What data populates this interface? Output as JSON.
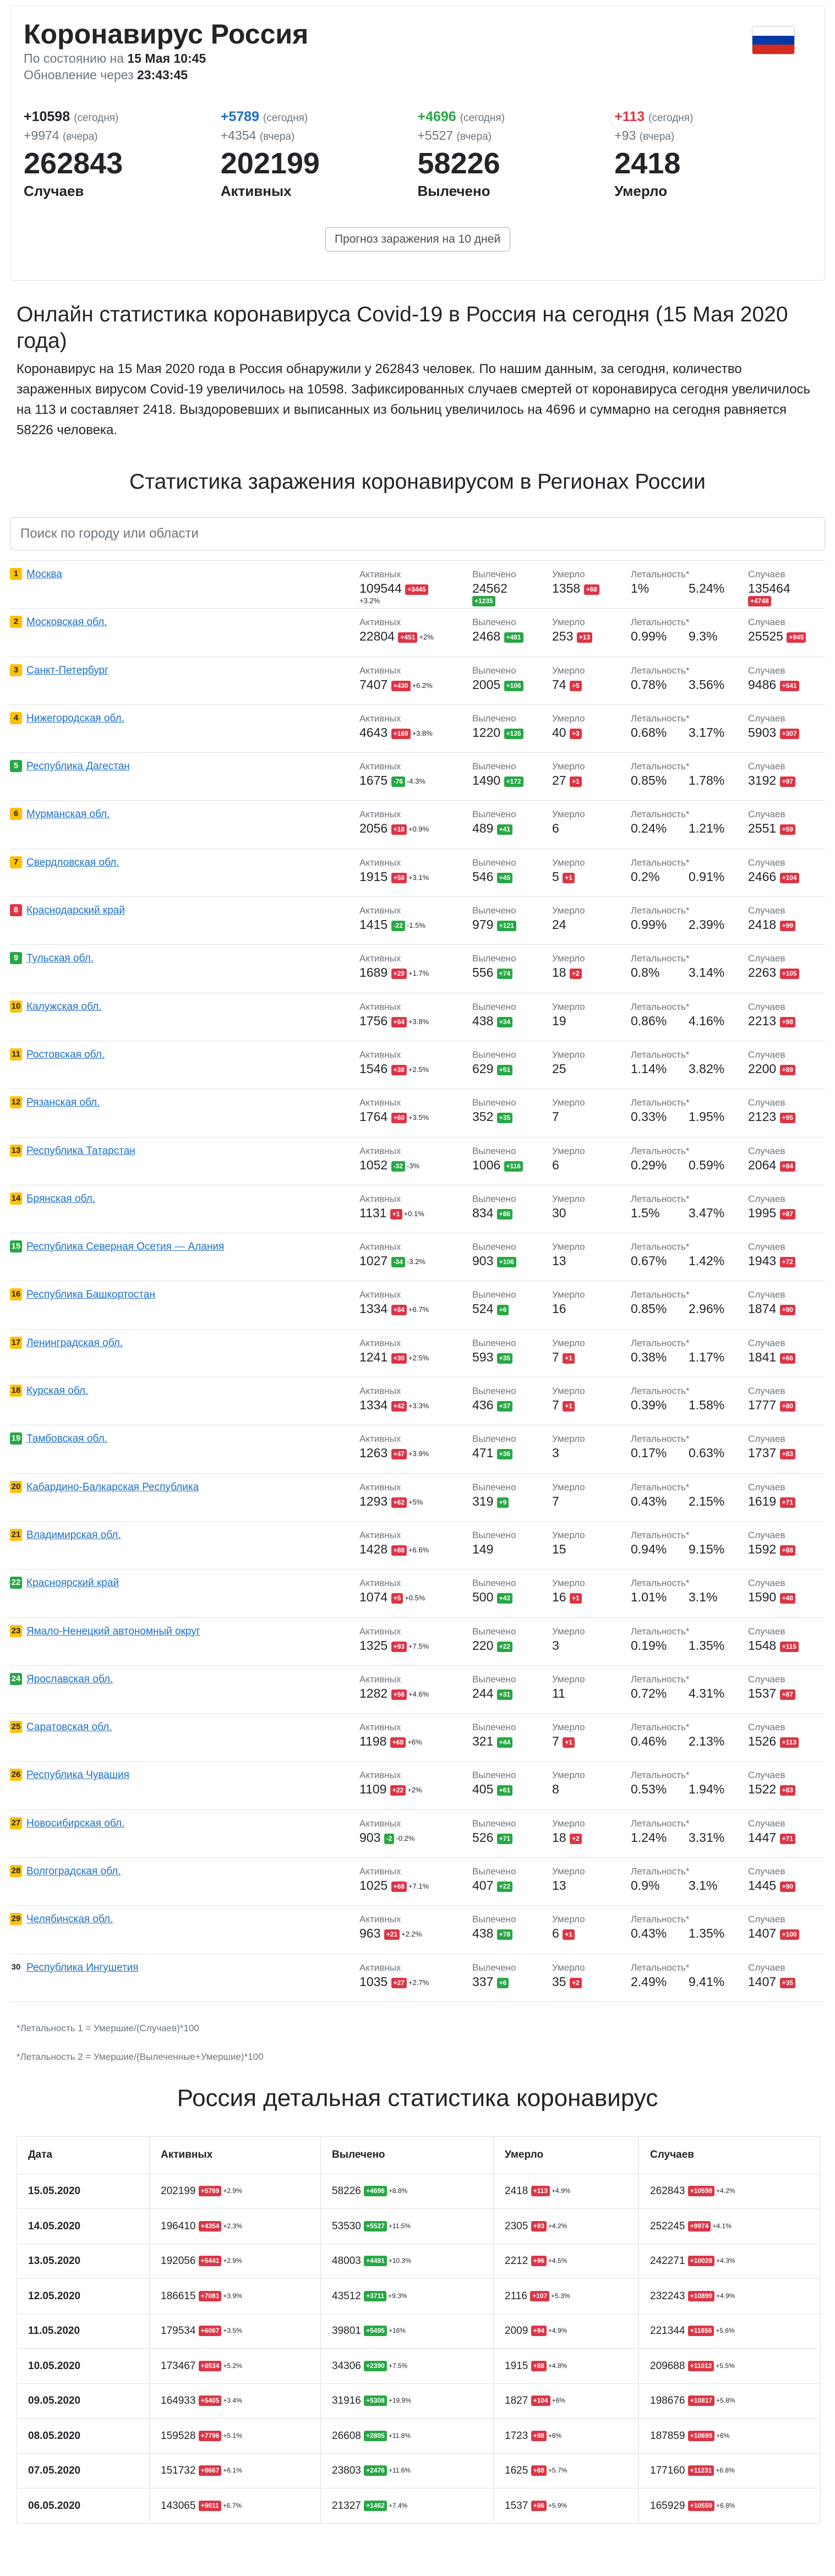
{
  "header": {
    "title": "Коронавирус Россия",
    "asof_label": "По состоянию на",
    "asof": "15 Мая 10:45",
    "update_label": "Обновление через",
    "update": "23:43:45"
  },
  "colors": {
    "blue": "#1f6fc7",
    "green": "#28a745",
    "red": "#dc3545",
    "yellow": "#ffc107"
  },
  "stats": [
    {
      "today": "+10598",
      "today_label": "(сегодня)",
      "yest": "+9974",
      "yest_label": "(вчера)",
      "total": "262843",
      "caption": "Случаев",
      "color": "dark"
    },
    {
      "today": "+5789",
      "today_label": "(сегодня)",
      "yest": "+4354",
      "yest_label": "(вчера)",
      "total": "202199",
      "caption": "Активных",
      "color": "blue"
    },
    {
      "today": "+4696",
      "today_label": "(сегодня)",
      "yest": "+5527",
      "yest_label": "(вчера)",
      "total": "58226",
      "caption": "Вылечено",
      "color": "green"
    },
    {
      "today": "+113",
      "today_label": "(сегодня)",
      "yest": "+93",
      "yest_label": "(вчера)",
      "total": "2418",
      "caption": "Умерло",
      "color": "red"
    }
  ],
  "forecast_button": "Прогноз заражения на 10 дней",
  "online_title": "Онлайн статистика коронавируса Covid-19 в Россия на сегодня (15 Мая 2020 года)",
  "intro": "Коронавирус на 15 Мая 2020 года в Россия обнаружили у 262843 человек. По нашим данным, за сегодня, количество зараженных вирусом Covid-19 увеличилось на 10598. Зафиксированных случаев смертей от коронавируса сегодня увеличилось на 113 и составляет 2418. Выздоровевших и выписанных из больниц увеличилось на 4696 и суммарно на сегодня равняется 58226 человека.",
  "regions_title": "Статистика заражения коронавирусом в Регионах России",
  "search_placeholder": "Поиск по городу или области",
  "labels": {
    "active": "Активных",
    "recovered": "Вылечено",
    "died": "Умерло",
    "lethality": "Летальность*",
    "cases": "Случаев"
  },
  "regions": [
    {
      "rank": "1",
      "badge": "y",
      "name": "Москва",
      "active": "109544",
      "ad": "+3445",
      "ap": "+3.2%",
      "rec": "24562",
      "rd": "+1235",
      "died": "1358",
      "dd": "+68",
      "l1": "1%",
      "l2": "5.24%",
      "cases": "135464",
      "cd": "+4748"
    },
    {
      "rank": "2",
      "badge": "y",
      "name": "Московская обл.",
      "active": "22804",
      "ad": "+451",
      "ap": "+2%",
      "rec": "2468",
      "rd": "+481",
      "died": "253",
      "dd": "+13",
      "l1": "0.99%",
      "l2": "9.3%",
      "cases": "25525",
      "cd": "+945"
    },
    {
      "rank": "3",
      "badge": "y",
      "name": "Санкт-Петербург",
      "active": "7407",
      "ad": "+430",
      "ap": "+6.2%",
      "rec": "2005",
      "rd": "+106",
      "died": "74",
      "dd": "+5",
      "l1": "0.78%",
      "l2": "3.56%",
      "cases": "9486",
      "cd": "+541"
    },
    {
      "rank": "4",
      "badge": "y",
      "name": "Нижегородская обл.",
      "active": "4643",
      "ad": "+169",
      "ap": "+3.8%",
      "rec": "1220",
      "rd": "+135",
      "died": "40",
      "dd": "+3",
      "l1": "0.68%",
      "l2": "3.17%",
      "cases": "5903",
      "cd": "+307"
    },
    {
      "rank": "5",
      "badge": "g",
      "name": "Республика Дагестан",
      "active": "1675",
      "ad": "-76",
      "ap": "-4.3%",
      "rec": "1490",
      "rd": "+172",
      "died": "27",
      "dd": "+1",
      "l1": "0.85%",
      "l2": "1.78%",
      "cases": "3192",
      "cd": "+97"
    },
    {
      "rank": "6",
      "badge": "y",
      "name": "Мурманская обл.",
      "active": "2056",
      "ad": "+18",
      "ap": "+0.9%",
      "rec": "489",
      "rd": "+41",
      "died": "6",
      "dd": "",
      "l1": "0.24%",
      "l2": "1.21%",
      "cases": "2551",
      "cd": "+59"
    },
    {
      "rank": "7",
      "badge": "y",
      "name": "Свердловская обл.",
      "active": "1915",
      "ad": "+58",
      "ap": "+3.1%",
      "rec": "546",
      "rd": "+45",
      "died": "5",
      "dd": "+1",
      "l1": "0.2%",
      "l2": "0.91%",
      "cases": "2466",
      "cd": "+104"
    },
    {
      "rank": "8",
      "badge": "r",
      "name": "Краснодарский край",
      "active": "1415",
      "ad": "-22",
      "ap": "-1.5%",
      "rec": "979",
      "rd": "+121",
      "died": "24",
      "dd": "",
      "l1": "0.99%",
      "l2": "2.39%",
      "cases": "2418",
      "cd": "+99"
    },
    {
      "rank": "9",
      "badge": "g",
      "name": "Тульская обл.",
      "active": "1689",
      "ad": "+29",
      "ap": "+1.7%",
      "rec": "556",
      "rd": "+74",
      "died": "18",
      "dd": "+2",
      "l1": "0.8%",
      "l2": "3.14%",
      "cases": "2263",
      "cd": "+105"
    },
    {
      "rank": "10",
      "badge": "y",
      "name": "Калужская обл.",
      "active": "1756",
      "ad": "+64",
      "ap": "+3.8%",
      "rec": "438",
      "rd": "+34",
      "died": "19",
      "dd": "",
      "l1": "0.86%",
      "l2": "4.16%",
      "cases": "2213",
      "cd": "+98"
    },
    {
      "rank": "11",
      "badge": "y",
      "name": "Ростовская обл.",
      "active": "1546",
      "ad": "+38",
      "ap": "+2.5%",
      "rec": "629",
      "rd": "+51",
      "died": "25",
      "dd": "",
      "l1": "1.14%",
      "l2": "3.82%",
      "cases": "2200",
      "cd": "+89"
    },
    {
      "rank": "12",
      "badge": "y",
      "name": "Рязанская обл.",
      "active": "1764",
      "ad": "+60",
      "ap": "+3.5%",
      "rec": "352",
      "rd": "+35",
      "died": "7",
      "dd": "",
      "l1": "0.33%",
      "l2": "1.95%",
      "cases": "2123",
      "cd": "+95"
    },
    {
      "rank": "13",
      "badge": "y",
      "name": "Республика Татарстан",
      "active": "1052",
      "ad": "-32",
      "ap": "-3%",
      "rec": "1006",
      "rd": "+116",
      "died": "6",
      "dd": "",
      "l1": "0.29%",
      "l2": "0.59%",
      "cases": "2064",
      "cd": "+84"
    },
    {
      "rank": "14",
      "badge": "y",
      "name": "Брянская обл.",
      "active": "1131",
      "ad": "+1",
      "ap": "+0.1%",
      "rec": "834",
      "rd": "+86",
      "died": "30",
      "dd": "",
      "l1": "1.5%",
      "l2": "3.47%",
      "cases": "1995",
      "cd": "+87"
    },
    {
      "rank": "15",
      "badge": "g",
      "name": "Республика Северная Осетия — Алания",
      "active": "1027",
      "ad": "-34",
      "ap": "-3.2%",
      "rec": "903",
      "rd": "+106",
      "died": "13",
      "dd": "",
      "l1": "0.67%",
      "l2": "1.42%",
      "cases": "1943",
      "cd": "+72"
    },
    {
      "rank": "16",
      "badge": "y",
      "name": "Республика Башкортостан",
      "active": "1334",
      "ad": "+84",
      "ap": "+6.7%",
      "rec": "524",
      "rd": "+6",
      "died": "16",
      "dd": "",
      "l1": "0.85%",
      "l2": "2.96%",
      "cases": "1874",
      "cd": "+90"
    },
    {
      "rank": "17",
      "badge": "y",
      "name": "Ленинградская обл.",
      "active": "1241",
      "ad": "+30",
      "ap": "+2.5%",
      "rec": "593",
      "rd": "+35",
      "died": "7",
      "dd": "+1",
      "l1": "0.38%",
      "l2": "1.17%",
      "cases": "1841",
      "cd": "+66"
    },
    {
      "rank": "18",
      "badge": "y",
      "name": "Курская обл.",
      "active": "1334",
      "ad": "+42",
      "ap": "+3.3%",
      "rec": "436",
      "rd": "+37",
      "died": "7",
      "dd": "+1",
      "l1": "0.39%",
      "l2": "1.58%",
      "cases": "1777",
      "cd": "+80"
    },
    {
      "rank": "19",
      "badge": "g",
      "name": "Тамбовская обл.",
      "active": "1263",
      "ad": "+47",
      "ap": "+3.9%",
      "rec": "471",
      "rd": "+36",
      "died": "3",
      "dd": "",
      "l1": "0.17%",
      "l2": "0.63%",
      "cases": "1737",
      "cd": "+83"
    },
    {
      "rank": "20",
      "badge": "y",
      "name": "Кабардино-Балкарская Республика",
      "active": "1293",
      "ad": "+62",
      "ap": "+5%",
      "rec": "319",
      "rd": "+9",
      "died": "7",
      "dd": "",
      "l1": "0.43%",
      "l2": "2.15%",
      "cases": "1619",
      "cd": "+71"
    },
    {
      "rank": "21",
      "badge": "y",
      "name": "Владимирская обл.",
      "active": "1428",
      "ad": "+88",
      "ap": "+6.6%",
      "rec": "149",
      "rd": "",
      "died": "15",
      "dd": "",
      "l1": "0.94%",
      "l2": "9.15%",
      "cases": "1592",
      "cd": "+88"
    },
    {
      "rank": "22",
      "badge": "g",
      "name": "Красноярский край",
      "active": "1074",
      "ad": "+5",
      "ap": "+0.5%",
      "rec": "500",
      "rd": "+42",
      "died": "16",
      "dd": "+1",
      "l1": "1.01%",
      "l2": "3.1%",
      "cases": "1590",
      "cd": "+48"
    },
    {
      "rank": "23",
      "badge": "y",
      "name": "Ямало-Ненецкий автономный округ",
      "active": "1325",
      "ad": "+93",
      "ap": "+7.5%",
      "rec": "220",
      "rd": "+22",
      "died": "3",
      "dd": "",
      "l1": "0.19%",
      "l2": "1.35%",
      "cases": "1548",
      "cd": "+115"
    },
    {
      "rank": "24",
      "badge": "g",
      "name": "Ярославская обл.",
      "active": "1282",
      "ad": "+56",
      "ap": "+4.6%",
      "rec": "244",
      "rd": "+31",
      "died": "11",
      "dd": "",
      "l1": "0.72%",
      "l2": "4.31%",
      "cases": "1537",
      "cd": "+87"
    },
    {
      "rank": "25",
      "badge": "y",
      "name": "Саратовская обл.",
      "active": "1198",
      "ad": "+68",
      "ap": "+6%",
      "rec": "321",
      "rd": "+44",
      "died": "7",
      "dd": "+1",
      "l1": "0.46%",
      "l2": "2.13%",
      "cases": "1526",
      "cd": "+113"
    },
    {
      "rank": "26",
      "badge": "y",
      "name": "Республика Чувашия",
      "active": "1109",
      "ad": "+22",
      "ap": "+2%",
      "rec": "405",
      "rd": "+61",
      "died": "8",
      "dd": "",
      "l1": "0.53%",
      "l2": "1.94%",
      "cases": "1522",
      "cd": "+83"
    },
    {
      "rank": "27",
      "badge": "y",
      "name": "Новосибирская обл.",
      "active": "903",
      "ad": "-2",
      "ap": "-0.2%",
      "rec": "526",
      "rd": "+71",
      "died": "18",
      "dd": "+2",
      "l1": "1.24%",
      "l2": "3.31%",
      "cases": "1447",
      "cd": "+71"
    },
    {
      "rank": "28",
      "badge": "y",
      "name": "Волгоградская обл.",
      "active": "1025",
      "ad": "+68",
      "ap": "+7.1%",
      "rec": "407",
      "rd": "+22",
      "died": "13",
      "dd": "",
      "l1": "0.9%",
      "l2": "3.1%",
      "cases": "1445",
      "cd": "+90"
    },
    {
      "rank": "29",
      "badge": "y",
      "name": "Челябинская обл.",
      "active": "963",
      "ad": "+21",
      "ap": "+2.2%",
      "rec": "438",
      "rd": "+78",
      "died": "6",
      "dd": "+1",
      "l1": "0.43%",
      "l2": "1.35%",
      "cases": "1407",
      "cd": "+100"
    },
    {
      "rank": "30",
      "badge": "w",
      "name": "Республика Ингушетия",
      "active": "1035",
      "ad": "+27",
      "ap": "+2.7%",
      "rec": "337",
      "rd": "+6",
      "died": "35",
      "dd": "+2",
      "l1": "2.49%",
      "l2": "9.41%",
      "cases": "1407",
      "cd": "+35"
    }
  ],
  "notes": [
    "*Летальность 1 = Умершие/(Случаев)*100",
    "*Летальность 2 = Умершие/(Вылеченные+Умершие)*100"
  ],
  "daily_title": "Россия детальная статистика коронавирус",
  "daily_headers": [
    "Дата",
    "Активных",
    "Вылечено",
    "Умерло",
    "Случаев"
  ],
  "daily": [
    {
      "date": "15.05.2020",
      "active": "202199",
      "ad": "+5789",
      "ap": "+2.9%",
      "rec": "58226",
      "rd": "+4696",
      "rp": "+8.8%",
      "died": "2418",
      "dd": "+113",
      "dp": "+4.9%",
      "cases": "262843",
      "cd": "+10598",
      "cp": "+4.2%"
    },
    {
      "date": "14.05.2020",
      "active": "196410",
      "ad": "+4354",
      "ap": "+2.3%",
      "rec": "53530",
      "rd": "+5527",
      "rp": "+11.5%",
      "died": "2305",
      "dd": "+93",
      "dp": "+4.2%",
      "cases": "252245",
      "cd": "+9974",
      "cp": "+4.1%"
    },
    {
      "date": "13.05.2020",
      "active": "192056",
      "ad": "+5441",
      "ap": "+2.9%",
      "rec": "48003",
      "rd": "+4491",
      "rp": "+10.3%",
      "died": "2212",
      "dd": "+96",
      "dp": "+4.5%",
      "cases": "242271",
      "cd": "+10028",
      "cp": "+4.3%"
    },
    {
      "date": "12.05.2020",
      "active": "186615",
      "ad": "+7081",
      "ap": "+3.9%",
      "rec": "43512",
      "rd": "+3711",
      "rp": "+9.3%",
      "died": "2116",
      "dd": "+107",
      "dp": "+5.3%",
      "cases": "232243",
      "cd": "+10899",
      "cp": "+4.9%"
    },
    {
      "date": "11.05.2020",
      "active": "179534",
      "ad": "+6067",
      "ap": "+3.5%",
      "rec": "39801",
      "rd": "+5495",
      "rp": "+16%",
      "died": "2009",
      "dd": "+94",
      "dp": "+4.9%",
      "cases": "221344",
      "cd": "+11656",
      "cp": "+5.6%"
    },
    {
      "date": "10.05.2020",
      "active": "173467",
      "ad": "+8534",
      "ap": "+5.2%",
      "rec": "34306",
      "rd": "+2390",
      "rp": "+7.5%",
      "died": "1915",
      "dd": "+88",
      "dp": "+4.8%",
      "cases": "209688",
      "cd": "+11012",
      "cp": "+5.5%"
    },
    {
      "date": "09.05.2020",
      "active": "164933",
      "ad": "+5405",
      "ap": "+3.4%",
      "rec": "31916",
      "rd": "+5308",
      "rp": "+19.9%",
      "died": "1827",
      "dd": "+104",
      "dp": "+6%",
      "cases": "198676",
      "cd": "+10817",
      "cp": "+5.8%"
    },
    {
      "date": "08.05.2020",
      "active": "159528",
      "ad": "+7796",
      "ap": "+5.1%",
      "rec": "26608",
      "rd": "+2805",
      "rp": "+11.8%",
      "died": "1723",
      "dd": "+98",
      "dp": "+6%",
      "cases": "187859",
      "cd": "+10699",
      "cp": "+6%"
    },
    {
      "date": "07.05.2020",
      "active": "151732",
      "ad": "+8667",
      "ap": "+6.1%",
      "rec": "23803",
      "rd": "+2476",
      "rp": "+11.6%",
      "died": "1625",
      "dd": "+88",
      "dp": "+5.7%",
      "cases": "177160",
      "cd": "+11231",
      "cp": "+6.8%"
    },
    {
      "date": "06.05.2020",
      "active": "143065",
      "ad": "+9011",
      "ap": "+6.7%",
      "rec": "21327",
      "rd": "+1462",
      "rp": "+7.4%",
      "died": "1537",
      "dd": "+86",
      "dp": "+5.9%",
      "cases": "165929",
      "cd": "+10559",
      "cp": "+6.8%"
    }
  ]
}
